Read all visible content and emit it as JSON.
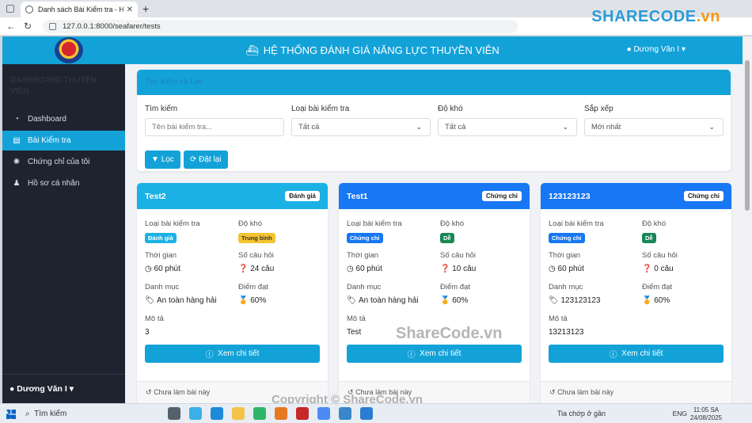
{
  "browser": {
    "tab_title": "Danh sách Bài Kiểm tra - Hệ thống",
    "url": "127.0.0.1:8000/seafarer/tests"
  },
  "watermark": {
    "brand": "SHARECODE",
    "brand_suffix": ".vn",
    "center": "ShareCode.vn",
    "bottom": "Copyright © ShareCode.vn"
  },
  "header": {
    "title": "HỆ THỐNG ĐÁNH GIÁ NĂNG LỰC THUYỀN VIÊN",
    "user": "Dương Văn I"
  },
  "sidebar": {
    "brand": "DASHBOARD THUYỀN VIÊN",
    "items": [
      {
        "label": "Dashboard",
        "icon": "gauge-icon"
      },
      {
        "label": "Bài Kiểm tra",
        "icon": "file-icon"
      },
      {
        "label": "Chứng chỉ của tôi",
        "icon": "certificate-icon"
      },
      {
        "label": "Hồ sơ cá nhân",
        "icon": "user-icon"
      }
    ],
    "active_index": 1,
    "user": "Dương Văn I"
  },
  "filter": {
    "title": "Tìm kiếm và Lọc",
    "search_label": "Tìm kiếm",
    "search_placeholder": "Tên bài kiểm tra...",
    "type_label": "Loại bài kiểm tra",
    "type_value": "Tất cả",
    "difficulty_label": "Độ khó",
    "difficulty_value": "Tất cả",
    "sort_label": "Sắp xếp",
    "sort_value": "Mới nhất",
    "filter_button": "Lọc",
    "reset_button": "Đặt lại"
  },
  "card_labels": {
    "type": "Loại bài kiểm tra",
    "difficulty": "Độ khó",
    "time": "Thời gian",
    "questions": "Số câu hỏi",
    "category": "Danh mục",
    "pass": "Điểm đạt",
    "description": "Mô tả",
    "detail_button": "Xem chi tiết",
    "status": "Chưa làm bài này"
  },
  "cards": [
    {
      "name": "Test2",
      "header_color": "#1bb1e4",
      "badge": "Đánh giá",
      "type": "Đánh giá",
      "type_color": "#1bb1e4",
      "difficulty": "Trung bình",
      "difficulty_color": "#f4c430",
      "time": "60 phút",
      "questions": "24 câu",
      "category": "An toàn hàng hải",
      "pass": "60%",
      "description": "3"
    },
    {
      "name": "Test1",
      "header_color": "#1877f2",
      "badge": "Chứng chỉ",
      "type": "Chứng chỉ",
      "type_color": "#1877f2",
      "difficulty": "Dễ",
      "difficulty_color": "#198754",
      "time": "60 phút",
      "questions": "10 câu",
      "category": "An toàn hàng hải",
      "pass": "60%",
      "description": "Test"
    },
    {
      "name": "123123123",
      "header_color": "#1877f2",
      "badge": "Chứng chỉ",
      "type": "Chứng chỉ",
      "type_color": "#1877f2",
      "difficulty": "Dễ",
      "difficulty_color": "#198754",
      "time": "60 phút",
      "questions": "0 câu",
      "category": "123123123",
      "pass": "60%",
      "description": "13213123"
    }
  ],
  "taskbar": {
    "search": "Tìm kiếm",
    "weather": "Tia chớp ở gần",
    "lang": "ENG",
    "time": "11:05 SA",
    "date": "24/08/2025"
  }
}
